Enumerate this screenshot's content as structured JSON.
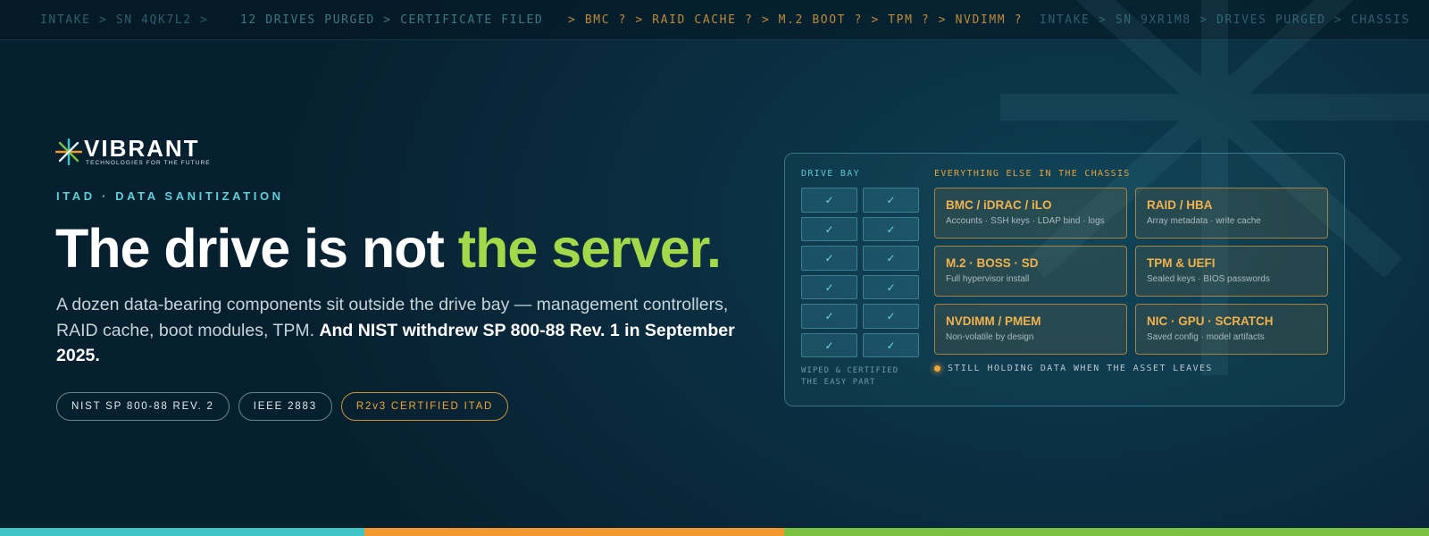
{
  "ticker": {
    "items": [
      "INTAKE > SN 4QK7L2 >",
      "12 DRIVES PURGED > CERTIFICATE FILED",
      "> BMC ? > RAID CACHE ? > M.2 BOOT ? > TPM ? > NVDIMM ?",
      "INTAKE > SN 9XR1M8 > DRIVES PURGED > CHASSIS"
    ]
  },
  "brand": {
    "name": "VIBRANT",
    "tagline": "TECHNOLOGIES FOR THE FUTURE"
  },
  "hero": {
    "eyebrow": "ITAD · DATA SANITIZATION",
    "headline_start": "The drive is not ",
    "headline_accent": "the server.",
    "lede": "A dozen data-bearing components sit outside the drive bay — management controllers, RAID cache, boot modules, TPM. ",
    "lede_bold": "And NIST withdrew SP 800-88 Rev. 1 in September 2025."
  },
  "pills": [
    "NIST SP 800-88 REV. 2",
    "IEEE 2883",
    "R2v3 CERTIFIED ITAD"
  ],
  "panel": {
    "bay_title": "DRIVE BAY",
    "check_mark": "✓",
    "bay_note_1": "WIPED & CERTIFIED",
    "bay_note_2": "THE EASY PART",
    "chassis_title": "EVERYTHING ELSE IN THE CHASSIS",
    "cards": [
      {
        "title": "BMC / iDRAC / iLO",
        "sub": "Accounts · SSH keys · LDAP bind · logs"
      },
      {
        "title": "RAID / HBA",
        "sub": "Array metadata · write cache"
      },
      {
        "title": "M.2 · BOSS · SD",
        "sub": "Full hypervisor install"
      },
      {
        "title": "TPM & UEFI",
        "sub": "Sealed keys · BIOS passwords"
      },
      {
        "title": "NVDIMM / PMEM",
        "sub": "Non-volatile by design"
      },
      {
        "title": "NIC · GPU · SCRATCH",
        "sub": "Saved config · model artifacts"
      }
    ],
    "still_text": "STILL HOLDING DATA WHEN THE ASSET LEAVES"
  },
  "colors": {
    "accent_green": "#a3d84a",
    "accent_cyan": "#5fd0d8",
    "accent_amber": "#f0a736",
    "stripe_cyan": "#3ec4c8",
    "stripe_orange": "#f1992c",
    "stripe_green": "#7cc242"
  },
  "icons": [
    "vibrant-starburst-icon",
    "asterisk-watermark-icon",
    "checkmark-icon",
    "status-dot-icon"
  ]
}
